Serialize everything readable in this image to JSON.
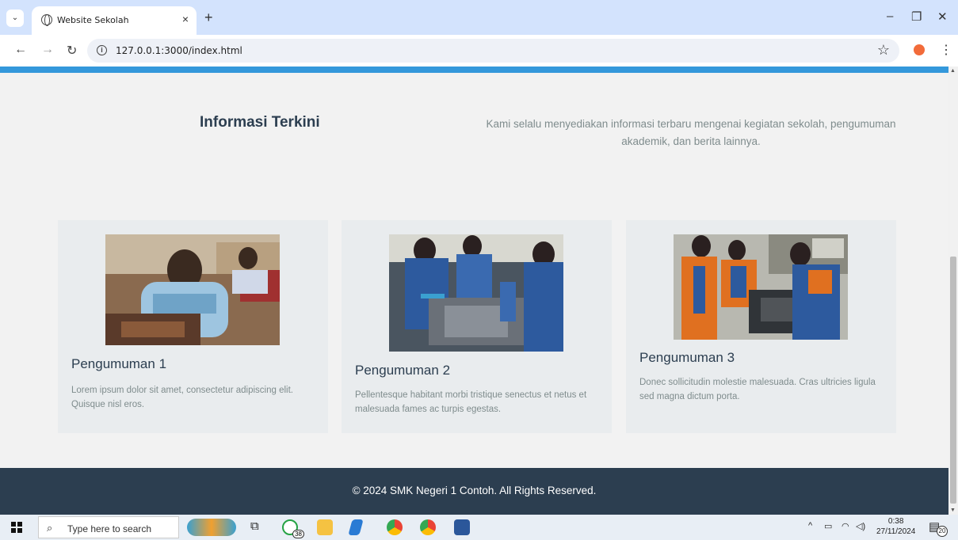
{
  "browser": {
    "tab_title": "Website Sekolah",
    "tab_close": "×",
    "new_tab": "+",
    "url": "127.0.0.1:3000/index.html",
    "minimize": "–",
    "restore": "❐",
    "close": "✕"
  },
  "page": {
    "section_title": "Informasi Terkini",
    "section_desc": "Kami selalu menyediakan informasi terbaru mengenai kegiatan sekolah, pengumuman akademik, dan berita lainnya.",
    "cards": [
      {
        "title": "Pengumuman 1",
        "text": "Lorem ipsum dolor sit amet, consectetur adipiscing elit. Quisque nisl eros."
      },
      {
        "title": "Pengumuman 2",
        "text": "Pellentesque habitant morbi tristique senectus et netus et malesuada fames ac turpis egestas."
      },
      {
        "title": "Pengumuman 3",
        "text": "Donec sollicitudin molestie malesuada. Cras ultricies ligula sed magna dictum porta."
      }
    ],
    "footer": "© 2024 SMK Negeri 1 Contoh. All Rights Reserved.",
    "colors": {
      "accent": "#3498db",
      "heading": "#2c3e50",
      "muted": "#7f8c8d",
      "footer_bg": "#2c3e50"
    }
  },
  "taskbar": {
    "search_placeholder": "Type here to search",
    "whatsapp_badge": "38",
    "time": "0:38",
    "date": "27/11/2024",
    "notification_count": "20"
  }
}
